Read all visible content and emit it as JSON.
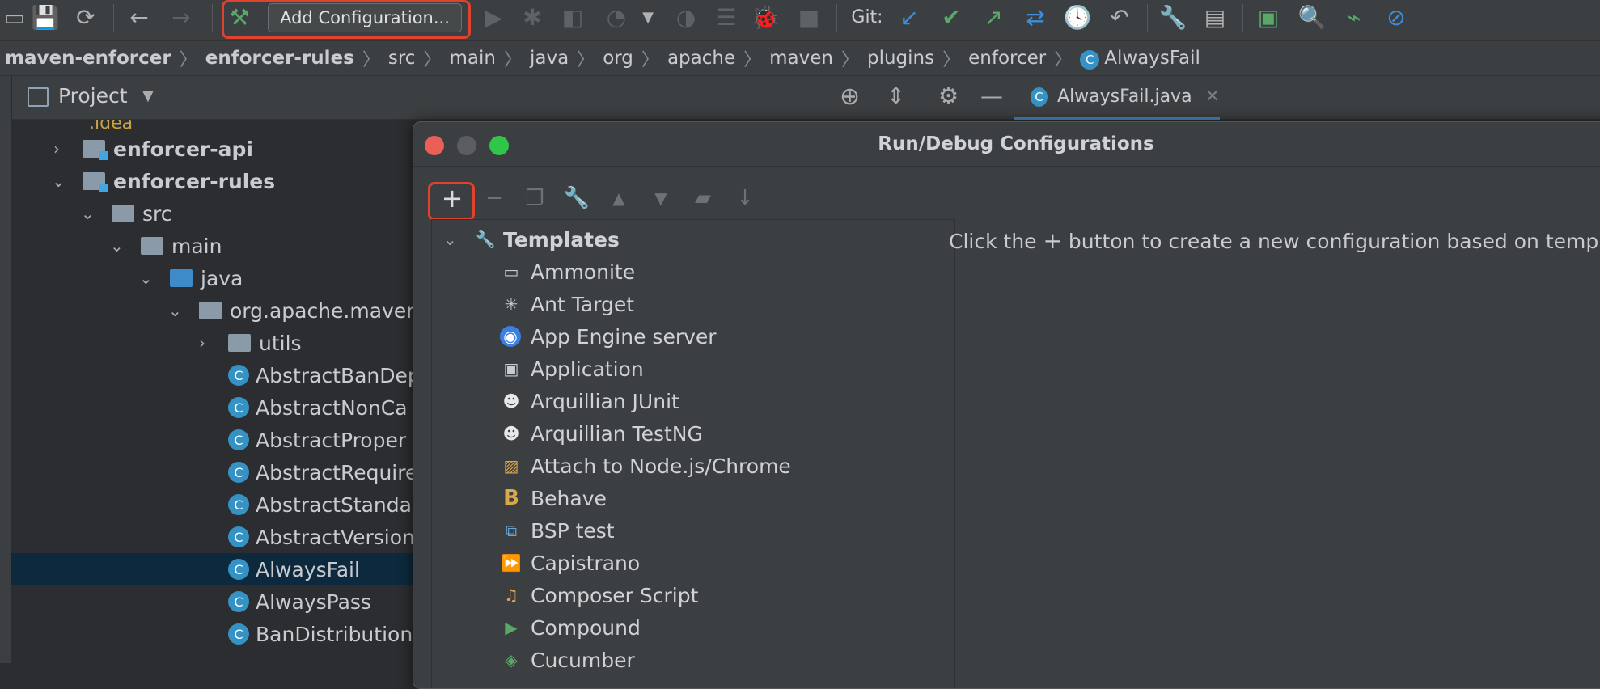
{
  "toolbar": {
    "add_configuration": "Add Configuration...",
    "git_label": "Git:"
  },
  "breadcrumbs": [
    "maven-enforcer",
    "enforcer-rules",
    "src",
    "main",
    "java",
    "org",
    "apache",
    "maven",
    "plugins",
    "enforcer",
    "AlwaysFail"
  ],
  "project_panel": {
    "title": "Project",
    "tree": [
      {
        "label": "enforcer-api",
        "bold": true
      },
      {
        "label": "enforcer-rules",
        "bold": true
      },
      {
        "label": "src"
      },
      {
        "label": "main"
      },
      {
        "label": "java"
      },
      {
        "label": "org.apache.maven"
      },
      {
        "label": "utils"
      },
      {
        "label": "AbstractBanDep"
      },
      {
        "label": "AbstractNonCa"
      },
      {
        "label": "AbstractProper"
      },
      {
        "label": "AbstractRequire"
      },
      {
        "label": "AbstractStanda"
      },
      {
        "label": "AbstractVersion"
      },
      {
        "label": "AlwaysFail",
        "selected": true
      },
      {
        "label": "AlwaysPass"
      },
      {
        "label": "BanDistribution"
      }
    ]
  },
  "editor_tab": {
    "label": "AlwaysFail.java"
  },
  "dialog": {
    "title": "Run/Debug Configurations",
    "templates_label": "Templates",
    "templates": [
      "Ammonite",
      "Ant Target",
      "App Engine server",
      "Application",
      "Arquillian JUnit",
      "Arquillian TestNG",
      "Attach to Node.js/Chrome",
      "Behave",
      "BSP test",
      "Capistrano",
      "Composer Script",
      "Compound",
      "Cucumber"
    ],
    "hint_before": "Click the",
    "hint_after": "button to create a new configuration based on templ"
  },
  "colors": {
    "highlight": "#e0432d",
    "selection": "#0d293e",
    "accent": "#4a88c7"
  }
}
